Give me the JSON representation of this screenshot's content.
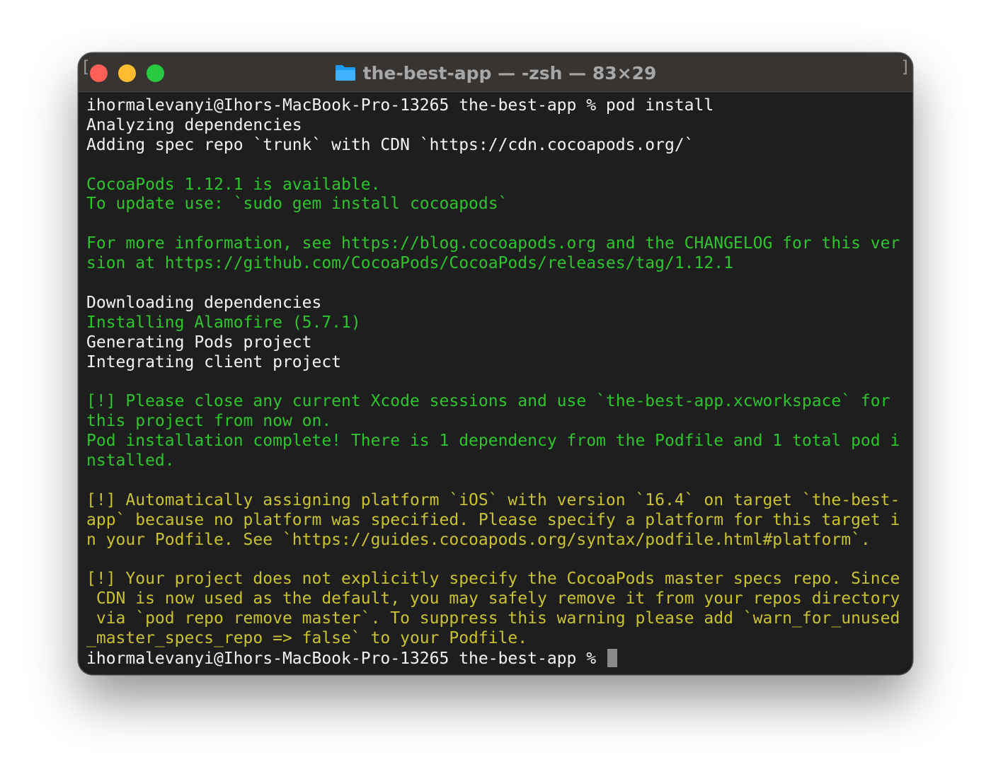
{
  "window": {
    "title": "the-best-app — -zsh — 83×29",
    "icon": "folder-icon"
  },
  "terminal": {
    "lines": [
      {
        "text": "ihormalevanyi@Ihors-MacBook-Pro-13265 the-best-app % pod install",
        "color": "white"
      },
      {
        "text": "Analyzing dependencies",
        "color": "white"
      },
      {
        "text": "Adding spec repo `trunk` with CDN `https://cdn.cocoapods.org/`",
        "color": "white"
      },
      {
        "text": "",
        "color": "white"
      },
      {
        "text": "CocoaPods 1.12.1 is available.",
        "color": "green"
      },
      {
        "text": "To update use: `sudo gem install cocoapods`",
        "color": "green"
      },
      {
        "text": "",
        "color": "white"
      },
      {
        "text": "For more information, see https://blog.cocoapods.org and the CHANGELOG for this ver",
        "color": "green"
      },
      {
        "text": "sion at https://github.com/CocoaPods/CocoaPods/releases/tag/1.12.1",
        "color": "green"
      },
      {
        "text": "",
        "color": "white"
      },
      {
        "text": "Downloading dependencies",
        "color": "white"
      },
      {
        "text": "Installing Alamofire (5.7.1)",
        "color": "green"
      },
      {
        "text": "Generating Pods project",
        "color": "white"
      },
      {
        "text": "Integrating client project",
        "color": "white"
      },
      {
        "text": "",
        "color": "white"
      },
      {
        "text": "[!] Please close any current Xcode sessions and use `the-best-app.xcworkspace` for",
        "color": "green"
      },
      {
        "text": "this project from now on.",
        "color": "green"
      },
      {
        "text": "Pod installation complete! There is 1 dependency from the Podfile and 1 total pod i",
        "color": "green"
      },
      {
        "text": "nstalled.",
        "color": "green"
      },
      {
        "text": "",
        "color": "white"
      },
      {
        "text": "[!] Automatically assigning platform `iOS` with version `16.4` on target `the-best-",
        "color": "yellow"
      },
      {
        "text": "app` because no platform was specified. Please specify a platform for this target i",
        "color": "yellow"
      },
      {
        "text": "n your Podfile. See `https://guides.cocoapods.org/syntax/podfile.html#platform`.",
        "color": "yellow"
      },
      {
        "text": "",
        "color": "white"
      },
      {
        "text": "[!] Your project does not explicitly specify the CocoaPods master specs repo. Since",
        "color": "yellow"
      },
      {
        "text": " CDN is now used as the default, you may safely remove it from your repos directory",
        "color": "yellow"
      },
      {
        "text": " via `pod repo remove master`. To suppress this warning please add `warn_for_unused",
        "color": "yellow"
      },
      {
        "text": "_master_specs_repo => false` to your Podfile.",
        "color": "yellow"
      }
    ],
    "prompt": "ihormalevanyi@Ihors-MacBook-Pro-13265 the-best-app % ",
    "colors": {
      "white": "#f4f4f4",
      "green": "#2fc42e",
      "yellow": "#c8c232"
    }
  }
}
